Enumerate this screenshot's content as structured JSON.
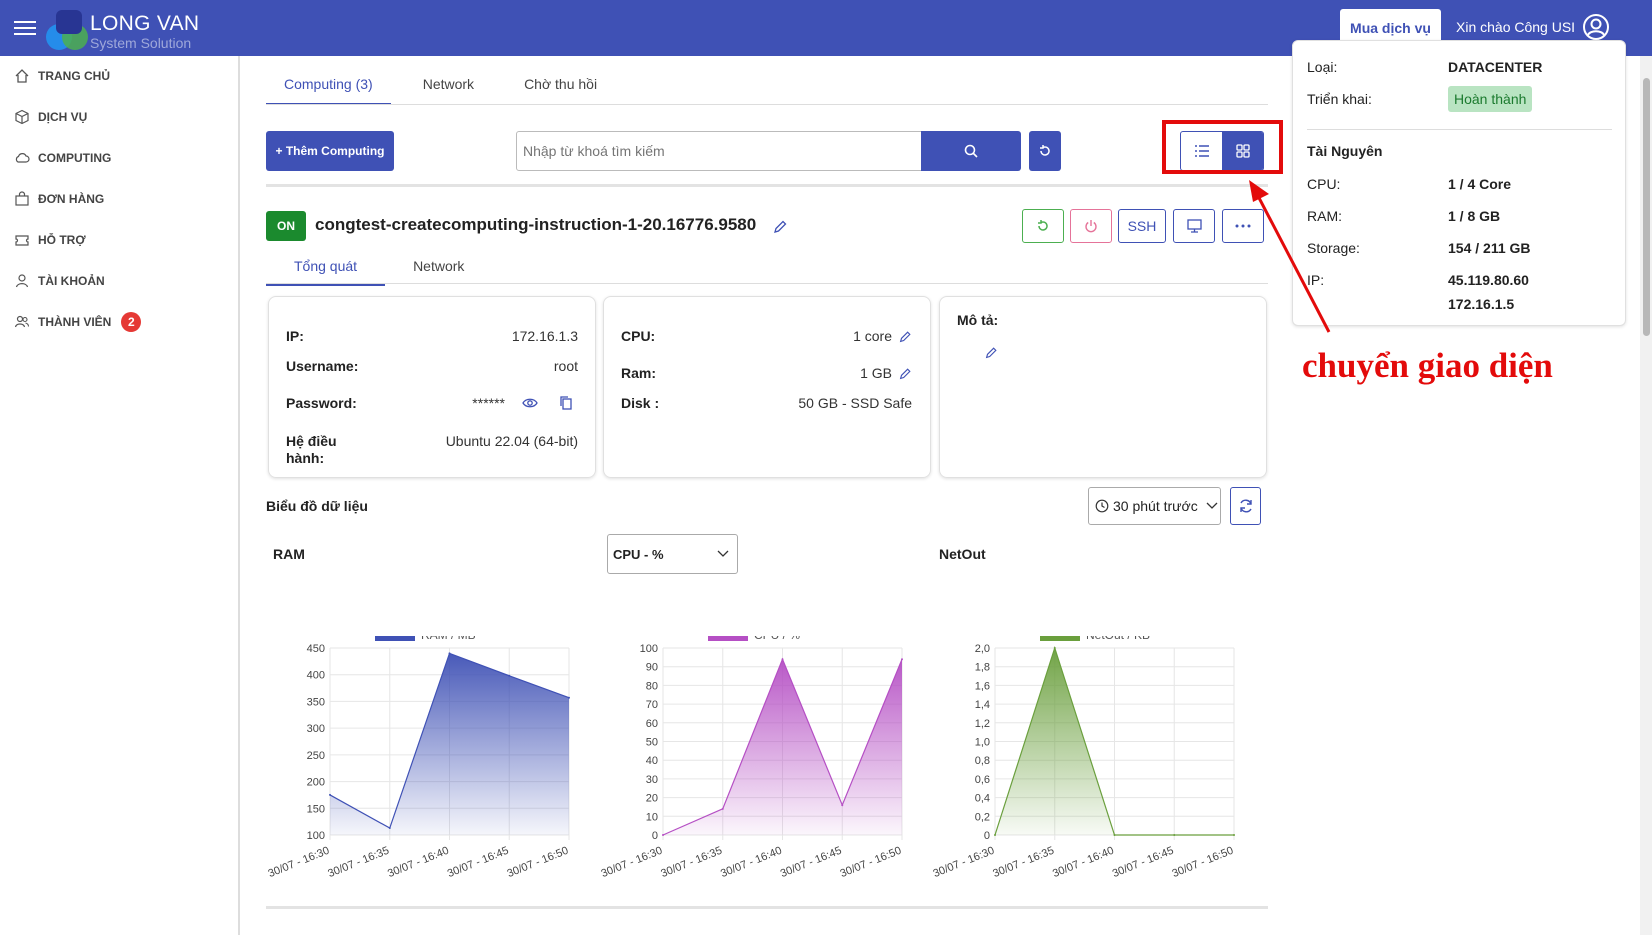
{
  "header": {
    "logo_title": "LONG VAN",
    "logo_subtitle": "System Solution",
    "buy_label": "Mua dịch vụ",
    "greeting": "Xin chào Công USI"
  },
  "sidebar": {
    "items": [
      {
        "label": "TRANG CHỦ"
      },
      {
        "label": "DỊCH VỤ"
      },
      {
        "label": "COMPUTING"
      },
      {
        "label": "ĐƠN HÀNG"
      },
      {
        "label": "HỖ TRỢ"
      },
      {
        "label": "TÀI KHOẢN"
      },
      {
        "label": "THÀNH VIÊN",
        "badge": "2"
      }
    ]
  },
  "main": {
    "tabs": [
      {
        "label": "Computing (3)"
      },
      {
        "label": "Network"
      },
      {
        "label": "Chờ thu hồi"
      }
    ],
    "add_label": "+ Thêm Computing",
    "search_placeholder": "Nhập từ khoá tìm kiếm",
    "vm": {
      "status": "ON",
      "name": "congtest-createcomputing-instruction-1-20.16776.9580",
      "ssh_label": "SSH",
      "subtabs": [
        {
          "label": "Tổng quát"
        },
        {
          "label": "Network"
        }
      ],
      "info": {
        "ip_label": "IP:",
        "ip": "172.16.1.3",
        "username_label": "Username:",
        "username": "root",
        "password_label": "Password:",
        "password": "******",
        "os_label_1": "Hệ điều",
        "os_label_2": "hành:",
        "os": "Ubuntu 22.04 (64-bit)"
      },
      "resources": {
        "cpu_label": "CPU:",
        "cpu": "1 core",
        "ram_label": "Ram:",
        "ram": "1 GB",
        "disk_label": "Disk :",
        "disk": "50 GB - SSD Safe"
      },
      "desc_label": "Mô tả:"
    },
    "charts_title": "Biểu đồ dữ liệu",
    "time_range": "30 phút trước",
    "ram_title": "RAM",
    "cpu_select": "CPU - %",
    "netout_title": "NetOut"
  },
  "right_panel": {
    "type_label": "Loại:",
    "type": "DATACENTER",
    "deploy_label": "Triển khai:",
    "deploy": "Hoàn thành",
    "res_title": "Tài Nguyên",
    "cpu_label": "CPU:",
    "cpu": "1 / 4 Core",
    "ram_label": "RAM:",
    "ram": "1 / 8 GB",
    "storage_label": "Storage:",
    "storage": "154 / 211 GB",
    "ip_label": "IP:",
    "ip1": "45.119.80.60",
    "ip2": "172.16.1.5"
  },
  "annotation": "chuyển giao diện",
  "colors": {
    "primary": "#3f51b5",
    "ram": "#3f51b5",
    "cpu": "#b54fc4",
    "netout": "#6a9f3d",
    "annotation": "#e30b0b"
  },
  "chart_data": [
    {
      "type": "area",
      "legend": "RAM / MB",
      "x": [
        "30/07 - 16:30",
        "30/07 - 16:35",
        "30/07 - 16:40",
        "30/07 - 16:45",
        "30/07 - 16:50"
      ],
      "series": [
        {
          "name": "RAM / MB",
          "points": [
            [
              0,
              175
            ],
            [
              1,
              113
            ],
            [
              2,
              440
            ],
            [
              3,
              398
            ],
            [
              4,
              357
            ]
          ]
        }
      ],
      "ylim": [
        100,
        450
      ],
      "yticks": [
        "100",
        "150",
        "200",
        "250",
        "300",
        "350",
        "400",
        "450"
      ]
    },
    {
      "type": "area",
      "legend": "CPU / %",
      "x": [
        "30/07 - 16:30",
        "30/07 - 16:35",
        "30/07 - 16:40",
        "30/07 - 16:45",
        "30/07 - 16:50"
      ],
      "series": [
        {
          "name": "CPU / %",
          "points": [
            [
              0,
              0
            ],
            [
              1,
              14
            ],
            [
              2,
              94
            ],
            [
              3,
              16
            ],
            [
              4,
              94
            ]
          ]
        }
      ],
      "ylim": [
        0,
        100
      ],
      "yticks": [
        "0",
        "10",
        "20",
        "30",
        "40",
        "50",
        "60",
        "70",
        "80",
        "90",
        "100"
      ]
    },
    {
      "type": "area",
      "legend": "NetOut / KB",
      "x": [
        "30/07 - 16:30",
        "30/07 - 16:35",
        "30/07 - 16:40",
        "30/07 - 16:45",
        "30/07 - 16:50"
      ],
      "series": [
        {
          "name": "NetOut / KB",
          "points": [
            [
              0,
              0
            ],
            [
              1,
              2.0
            ],
            [
              2,
              0
            ],
            [
              3,
              0
            ],
            [
              4,
              0
            ]
          ]
        }
      ],
      "ylim": [
        0,
        2.0
      ],
      "yticks": [
        "0",
        "0,2",
        "0,4",
        "0,6",
        "0,8",
        "1,0",
        "1,2",
        "1,4",
        "1,6",
        "1,8",
        "2,0"
      ]
    }
  ]
}
